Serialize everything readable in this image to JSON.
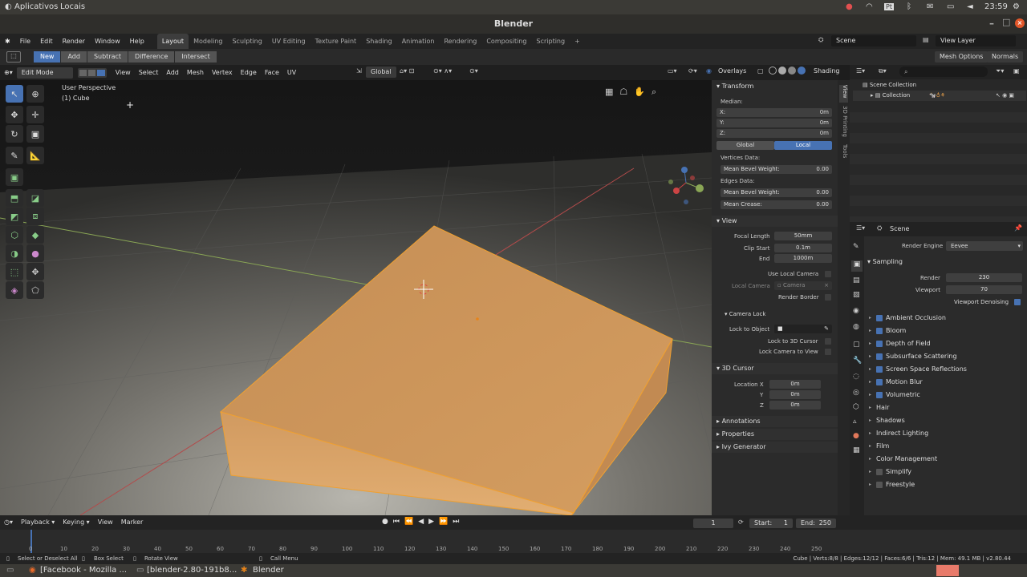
{
  "os": {
    "apps": "Aplicativos",
    "places": "Locais",
    "clock": "23:59"
  },
  "window": {
    "title": "Blender"
  },
  "menu": [
    "File",
    "Edit",
    "Render",
    "Window",
    "Help"
  ],
  "workspaces": [
    {
      "label": "Layout",
      "active": true
    },
    {
      "label": "Modeling"
    },
    {
      "label": "Sculpting"
    },
    {
      "label": "UV Editing"
    },
    {
      "label": "Texture Paint"
    },
    {
      "label": "Shading"
    },
    {
      "label": "Animation"
    },
    {
      "label": "Rendering"
    },
    {
      "label": "Compositing"
    },
    {
      "label": "Scripting"
    },
    {
      "label": "+"
    }
  ],
  "scene": {
    "name": "Scene",
    "view_layer": "View Layer"
  },
  "toolopts": {
    "buttons": [
      {
        "label": "New",
        "active": true
      },
      {
        "label": "Add"
      },
      {
        "label": "Subtract"
      },
      {
        "label": "Difference"
      },
      {
        "label": "Intersect"
      }
    ],
    "mesh_options": "Mesh Options",
    "normals": "Normals"
  },
  "vphead": {
    "mode": "Edit Mode",
    "menus": [
      "View",
      "Select",
      "Add",
      "Mesh",
      "Vertex",
      "Edge",
      "Face",
      "UV"
    ],
    "orientation": "Global",
    "overlays": "Overlays",
    "shading": "Shading"
  },
  "viewport": {
    "perspective": "User Perspective",
    "object": "(1) Cube"
  },
  "npanel": {
    "transform": "Transform",
    "median": "Median:",
    "x_label": "X:",
    "x": "0m",
    "y_label": "Y:",
    "y": "0m",
    "z_label": "Z:",
    "z": "0m",
    "global": "Global",
    "local": "Local",
    "vertices_data": "Vertices Data:",
    "mean_bevel_v_label": "Mean Bevel Weight:",
    "mean_bevel_v": "0.00",
    "edges_data": "Edges Data:",
    "mean_bevel_e_label": "Mean Bevel Weight:",
    "mean_bevel_e": "0.00",
    "mean_crease_label": "Mean Crease:",
    "mean_crease": "0.00",
    "view": "View",
    "focal_label": "Focal Length",
    "focal": "50mm",
    "clip_start_label": "Clip Start",
    "clip_start": "0.1m",
    "end_label": "End",
    "end": "1000m",
    "use_local_camera": "Use Local Camera",
    "local_camera_label": "Local Camera",
    "local_camera": "Camera",
    "render_border": "Render Border",
    "camera_lock": "Camera Lock",
    "lock_object": "Lock to Object",
    "lock_cursor": "Lock to 3D Cursor",
    "lock_camera": "Lock Camera to View",
    "cursor": "3D Cursor",
    "loc_x_label": "Location X",
    "loc_x": "0m",
    "loc_y_label": "Y",
    "loc_y": "0m",
    "loc_z_label": "Z",
    "loc_z": "0m",
    "annotations": "Annotations",
    "properties": "Properties",
    "ivy": "Ivy Generator",
    "tabs": [
      "View",
      "3D Printing",
      "Tools"
    ]
  },
  "outliner": {
    "scene_collection": "Scene Collection",
    "collection": "Collection"
  },
  "props": {
    "scene": "Scene",
    "engine_label": "Render Engine",
    "engine": "Eevee",
    "sampling": "Sampling",
    "render_label": "Render",
    "render": "230",
    "viewport_label": "Viewport",
    "viewport": "70",
    "denoise": "Viewport Denoising",
    "items": [
      {
        "label": "Ambient Occlusion",
        "check": true
      },
      {
        "label": "Bloom",
        "check": true
      },
      {
        "label": "Depth of Field",
        "check": true
      },
      {
        "label": "Subsurface Scattering",
        "check": true
      },
      {
        "label": "Screen Space Reflections",
        "check": true
      },
      {
        "label": "Motion Blur",
        "check": true
      },
      {
        "label": "Volumetric",
        "check": true
      },
      {
        "label": "Hair"
      },
      {
        "label": "Shadows"
      },
      {
        "label": "Indirect Lighting"
      },
      {
        "label": "Film"
      },
      {
        "label": "Color Management"
      },
      {
        "label": "Simplify",
        "check": false
      },
      {
        "label": "Freestyle",
        "check": false
      }
    ]
  },
  "timeline": {
    "menus": [
      "Playback",
      "Keying",
      "View",
      "Marker"
    ],
    "frame": "1",
    "start_label": "Start:",
    "start": "1",
    "end_label": "End:",
    "end": "250",
    "ticks": [
      "0",
      "10",
      "20",
      "30",
      "40",
      "50",
      "60",
      "70",
      "80",
      "90",
      "100",
      "110",
      "120",
      "130",
      "140",
      "150",
      "160",
      "170",
      "180",
      "190",
      "200",
      "210",
      "220",
      "230",
      "240",
      "250"
    ]
  },
  "status": {
    "select": "Select or Deselect All",
    "box": "Box Select",
    "rotate": "Rotate View",
    "menu": "Call Menu",
    "stats": "Cube | Verts:8/8 | Edges:12/12 | Faces:6/6 | Tris:12 | Mem: 49.1 MB | v2.80.44"
  },
  "taskbar": {
    "items": [
      "[Facebook - Mozilla ...",
      "[blender-2.80-191b8...",
      "Blender"
    ]
  }
}
